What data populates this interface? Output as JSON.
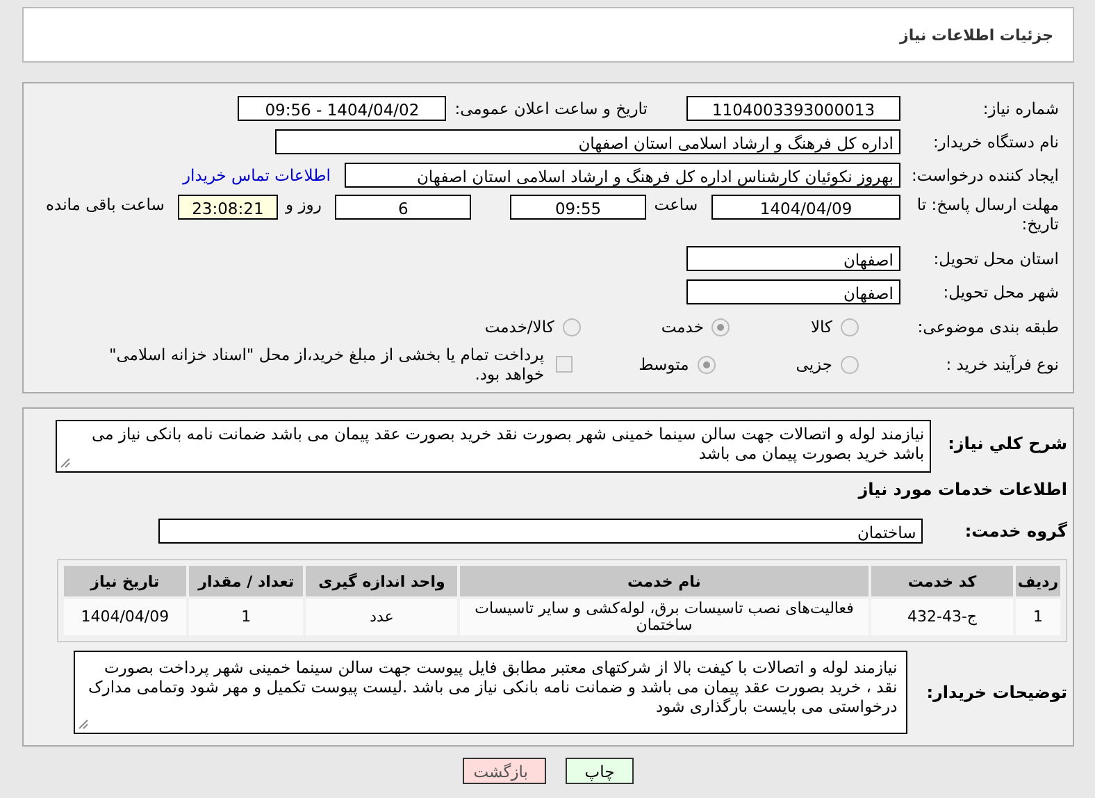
{
  "header": {
    "title": "جزئیات اطلاعات نیاز"
  },
  "need": {
    "number_label": "شماره نیاز:",
    "number": "1104003393000013",
    "announce_label": "تاریخ و ساعت اعلان عمومی:",
    "announce": "1404/04/02 - 09:56"
  },
  "buyer": {
    "label": "نام دستگاه خریدار:",
    "value": "اداره کل فرهنگ و ارشاد اسلامی استان اصفهان"
  },
  "requester": {
    "label": "ایجاد کننده درخواست:",
    "value": "بهروز نکوئیان کارشناس اداره کل فرهنگ و ارشاد اسلامی استان اصفهان",
    "contact_link": "اطلاعات تماس خریدار"
  },
  "deadline": {
    "label": "مهلت ارسال پاسخ: تا تاریخ:",
    "date": "1404/04/09",
    "time_label": "ساعت",
    "time": "09:55",
    "days": "6",
    "days_label": "روز و",
    "remaining": "23:08:21",
    "remaining_label": "ساعت باقی مانده"
  },
  "province": {
    "label": "استان محل تحویل:",
    "value": "اصفهان"
  },
  "city": {
    "label": "شهر محل تحویل:",
    "value": "اصفهان"
  },
  "category": {
    "label": "طبقه بندی موضوعی:",
    "options": [
      {
        "label": "کالا",
        "selected": false
      },
      {
        "label": "خدمت",
        "selected": true
      },
      {
        "label": "کالا/خدمت",
        "selected": false
      }
    ]
  },
  "process": {
    "label": "نوع فرآیند خرید :",
    "options": [
      {
        "label": "جزیی",
        "selected": false
      },
      {
        "label": "متوسط",
        "selected": true
      }
    ],
    "payment": {
      "checked": false,
      "text": "پرداخت تمام یا بخشی از مبلغ خرید،از محل \"اسناد خزانه اسلامی\" خواهد بود."
    }
  },
  "description": {
    "label": "شرح كلي نياز:",
    "text": "نیازمند لوله و اتصالات جهت سالن سینما خمینی شهر بصورت نقد خرید بصورت عقد پیمان می باشد ضمانت نامه بانکی نیاز می باشد خرید بصورت پیمان می باشد"
  },
  "services": {
    "title": "اطلاعات خدمات مورد نیاز",
    "group_label": "گروه خدمت:",
    "group": "ساختمان"
  },
  "table": {
    "columns": [
      "ردیف",
      "کد خدمت",
      "نام خدمت",
      "واحد اندازه گیری",
      "تعداد / مقدار",
      "تاریخ نیاز"
    ],
    "rows": [
      [
        "1",
        "ج-43-432",
        "فعالیت‌های نصب تاسیسات برق، لوله‌کشی و سایر تاسیسات ساختمان",
        "عدد",
        "1",
        "1404/04/09"
      ]
    ]
  },
  "buyer_notes": {
    "label": "توضیحات خریدار:",
    "text": "نیازمند لوله و اتصالات با کیفت بالا از شرکتهای معتبر مطابق فایل پیوست  جهت سالن سینما خمینی شهر پرداخت بصورت نقد ، خرید بصورت عقد پیمان می باشد و ضمانت نامه بانکی نیاز می باشد .لیست پیوست تکمیل و مهر شود وتمامی مدارک درخواستی می بایست بارگذاری شود"
  },
  "buttons": [
    {
      "label": "چاپ",
      "kind": "print"
    },
    {
      "label": "بازگشت",
      "kind": "back"
    }
  ]
}
